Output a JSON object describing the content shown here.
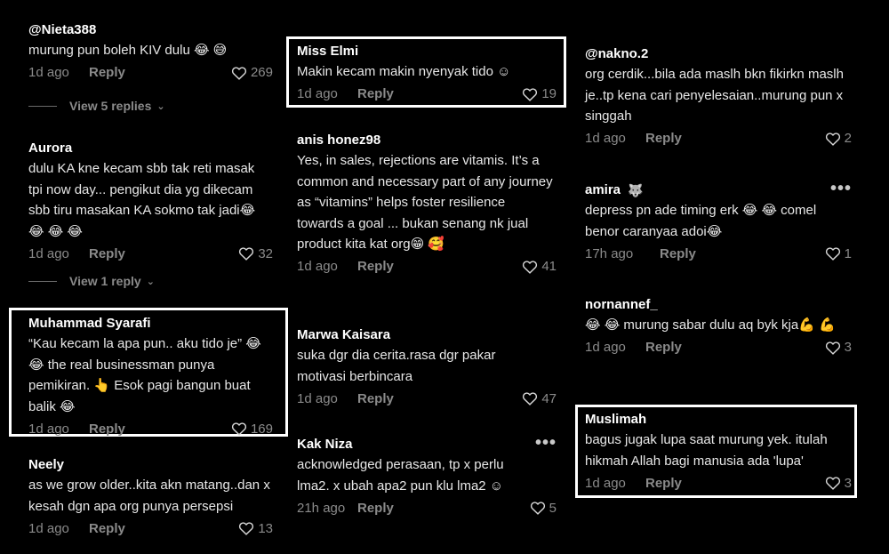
{
  "col1": [
    {
      "user": "@Nieta388",
      "text": "murung pun boleh KIV dulu 😂 😅",
      "time": "1d ago",
      "reply": "Reply",
      "likes": "269"
    },
    {
      "view": "View 5 replies"
    },
    {
      "user": "Aurora",
      "text": "dulu KA kne kecam sbb tak reti masak tpi now day... pengikut dia yg dikecam sbb tiru masakan KA sokmo tak jadi😂 😂 😂 😂",
      "time": "1d ago",
      "reply": "Reply",
      "likes": "32"
    },
    {
      "view": "View 1 reply"
    },
    {
      "user": "Muhammad Syarafi",
      "text": "“Kau kecam la apa pun.. aku tido je” 😂 😂 the real businessman punya pemikiran. 👆 Esok pagi bangun buat balik 😂",
      "time": "1d ago",
      "reply": "Reply",
      "likes": "169"
    },
    {
      "user": "Neely",
      "text": "as we grow older..kita akn matang..dan x kesah dgn apa org punya persepsi",
      "time": "1d ago",
      "reply": "Reply",
      "likes": "13"
    }
  ],
  "col2": [
    {
      "user": "Miss Elmi",
      "text": "Makin kecam makin nyenyak tido ☺",
      "time": "1d ago",
      "reply": "Reply",
      "likes": "19"
    },
    {
      "user": "anis honez98",
      "text": "Yes, in sales, rejections are vitamis. It’s a common and necessary part of any journey as “vitamins” helps foster resilience towards a goal ... bukan senang nk jual product kita kat org😁 🥰",
      "time": "1d ago",
      "reply": "Reply",
      "likes": "41"
    },
    {
      "user": "Marwa Kaisara",
      "text": "suka dgr dia cerita.rasa dgr pakar motivasi berbincara",
      "time": "1d ago",
      "reply": "Reply",
      "likes": "47"
    },
    {
      "user": "Kak Niza",
      "text": "acknowledged perasaan, tp x perlu lma2. x ubah apa2 pun klu lma2 ☺",
      "time": "21h ago",
      "reply": "Reply",
      "likes": "5",
      "more": "•••"
    }
  ],
  "col3": [
    {
      "user": "@nakno.2",
      "text": "org cerdik...bila ada maslh bkn fikirkn maslh je..tp kena cari penyelesaian..murung pun x singgah",
      "time": "1d ago",
      "reply": "Reply",
      "likes": "2"
    },
    {
      "user": "amira",
      "badge": "🐺",
      "text": "depress pn ade timing erk 😂 😂 comel benor caranyaa adoi😂",
      "time": "17h ago",
      "reply": "Reply",
      "likes": "1",
      "more": "•••"
    },
    {
      "user": "nornannef_",
      "text": "😂 😂 murung sabar dulu aq byk kja💪 💪",
      "time": "1d ago",
      "reply": "Reply",
      "likes": "3"
    },
    {
      "user": "Muslimah",
      "text": "bagus jugak lupa saat murung yek. itulah hikmah Allah bagi manusia ada 'lupa'",
      "time": "1d ago",
      "reply": "Reply",
      "likes": "3"
    }
  ]
}
